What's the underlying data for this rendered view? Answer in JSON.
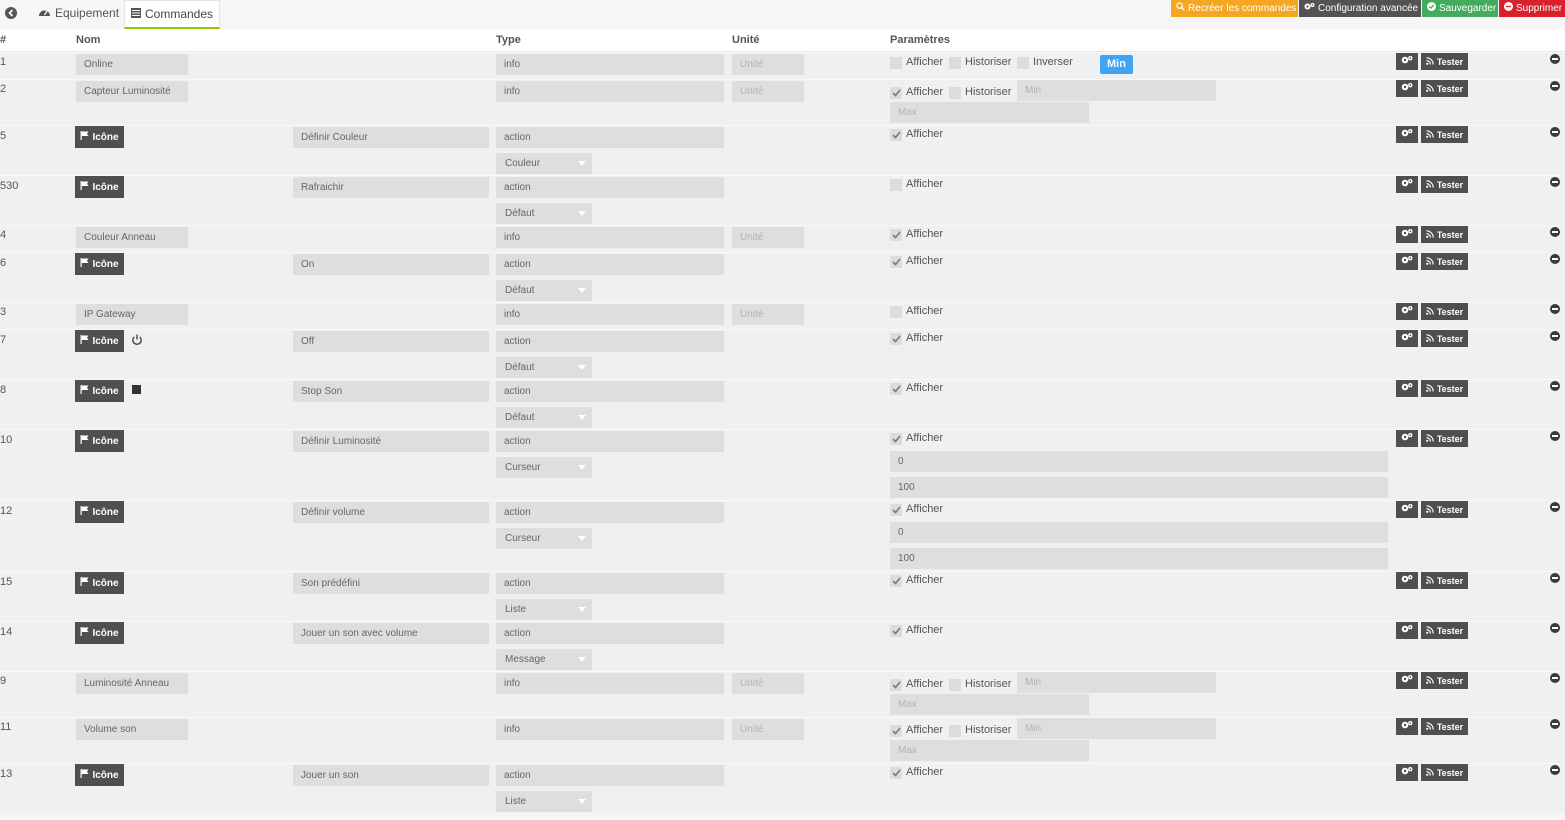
{
  "tabs": {
    "equipment": "Equipement",
    "commands": "Commandes"
  },
  "toolbar": {
    "recreate": "Recréer les commandes",
    "advanced_config": "Configuration avancée",
    "save": "Sauvegarder",
    "delete": "Supprimer"
  },
  "columns": {
    "id": "#",
    "name": "Nom",
    "type": "Type",
    "unit": "Unité",
    "params": "Paramètres"
  },
  "labels": {
    "icone": "Icône",
    "tester": "Tester",
    "afficher": "Afficher",
    "historiser": "Historiser",
    "inverser": "Inverser",
    "min_ph": "Min",
    "max_ph": "Max",
    "unit_ph": "Unité"
  },
  "tooltip": "Min",
  "colors": {
    "orange": "#f5a623",
    "dark": "#535353",
    "green": "#43ab5c",
    "red": "#d9212e",
    "tab_underline": "#94ca02",
    "tooltip": "#3da5f4"
  },
  "commands": [
    {
      "id": "1",
      "name": "Online",
      "type": "info",
      "afficher": false,
      "historiser": false,
      "inverser": false
    },
    {
      "id": "2",
      "name": "Capteur Luminosité",
      "type": "info",
      "afficher": true,
      "historiser": false
    },
    {
      "id": "5",
      "name": "Définir Couleur",
      "type": "action",
      "subtype": "Couleur",
      "afficher": true
    },
    {
      "id": "530",
      "name": "Rafraichir",
      "type": "action",
      "subtype": "Défaut",
      "afficher": false
    },
    {
      "id": "4",
      "name": "Couleur Anneau",
      "type": "info",
      "afficher": true
    },
    {
      "id": "6",
      "name": "On",
      "type": "action",
      "subtype": "Défaut",
      "afficher": true
    },
    {
      "id": "3",
      "name": "IP Gateway",
      "type": "info",
      "afficher": false
    },
    {
      "id": "7",
      "name": "Off",
      "type": "action",
      "subtype": "Défaut",
      "afficher": true,
      "icon": "power-icon"
    },
    {
      "id": "8",
      "name": "Stop Son",
      "type": "action",
      "subtype": "Défaut",
      "afficher": true,
      "icon": "stop-icon"
    },
    {
      "id": "10",
      "name": "Définir Luminosité",
      "type": "action",
      "subtype": "Curseur",
      "afficher": true,
      "min": "0",
      "max": "100"
    },
    {
      "id": "12",
      "name": "Définir volume",
      "type": "action",
      "subtype": "Curseur",
      "afficher": true,
      "min": "0",
      "max": "100"
    },
    {
      "id": "15",
      "name": "Son prédéfini",
      "type": "action",
      "subtype": "Liste",
      "afficher": true
    },
    {
      "id": "14",
      "name": "Jouer un son avec volume",
      "type": "action",
      "subtype": "Message",
      "afficher": true
    },
    {
      "id": "9",
      "name": "Luminosité Anneau",
      "type": "info",
      "afficher": true,
      "historiser": false
    },
    {
      "id": "11",
      "name": "Volume son",
      "type": "info",
      "afficher": true,
      "historiser": false
    },
    {
      "id": "13",
      "name": "Jouer un son",
      "type": "action",
      "subtype": "Liste",
      "afficher": true
    }
  ]
}
